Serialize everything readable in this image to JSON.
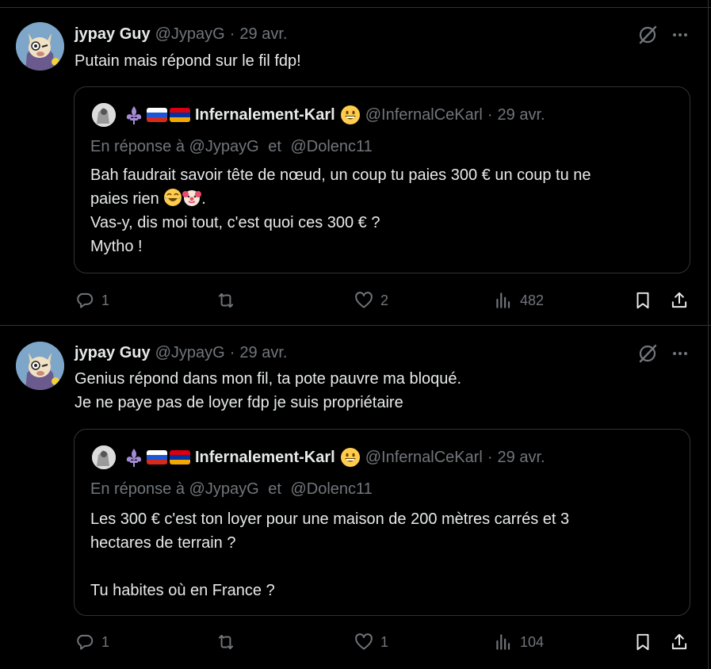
{
  "tweets": [
    {
      "author_name": "jypay Guy",
      "author_handle": "@JypayG",
      "separator": "·",
      "date": "29 avr.",
      "text": "Putain mais répond sur le fil fdp!",
      "quote": {
        "name": "Infernalement-Karl",
        "handle": "@InfernalCeKarl",
        "date": "29 avr.",
        "reply_prefix": "En réponse à",
        "reply_to_1": "@JypayG",
        "reply_and": "et",
        "reply_to_2": "@Dolenc11",
        "text_line1": "Bah faudrait savoir tête de nœud, un coup tu paies 300 € un coup tu ne",
        "text_line2": "paies rien",
        "text_rest": ".\nVas-y, dis moi tout, c'est quoi ces 300 € ?\nMytho !"
      },
      "replies": "1",
      "retweets": "",
      "likes": "2",
      "views": "482"
    },
    {
      "author_name": "jypay Guy",
      "author_handle": "@JypayG",
      "separator": "·",
      "date": "29 avr.",
      "text": "Genius répond dans mon fil, ta pote pauvre ma bloqué.\nJe ne paye pas de loyer fdp je suis propriétaire",
      "quote": {
        "name": "Infernalement-Karl",
        "handle": "@InfernalCeKarl",
        "date": "29 avr.",
        "reply_prefix": "En réponse à",
        "reply_to_1": "@JypayG",
        "reply_and": "et",
        "reply_to_2": "@Dolenc11",
        "text": "Les 300 € c'est ton loyer pour une maison de 200 mètres carrés et 3\nhectares de terrain ?\n\nTu habites où en France ?"
      },
      "replies": "1",
      "retweets": "",
      "likes": "1",
      "views": "104"
    }
  ],
  "colors": {
    "background": "#000000",
    "text": "#e7e9ea",
    "secondary": "#71767b",
    "border": "#2f3336"
  },
  "icons": [
    "grok-icon",
    "more-icon",
    "reply-icon",
    "retweet-icon",
    "like-icon",
    "views-icon",
    "bookmark-icon",
    "share-icon"
  ]
}
